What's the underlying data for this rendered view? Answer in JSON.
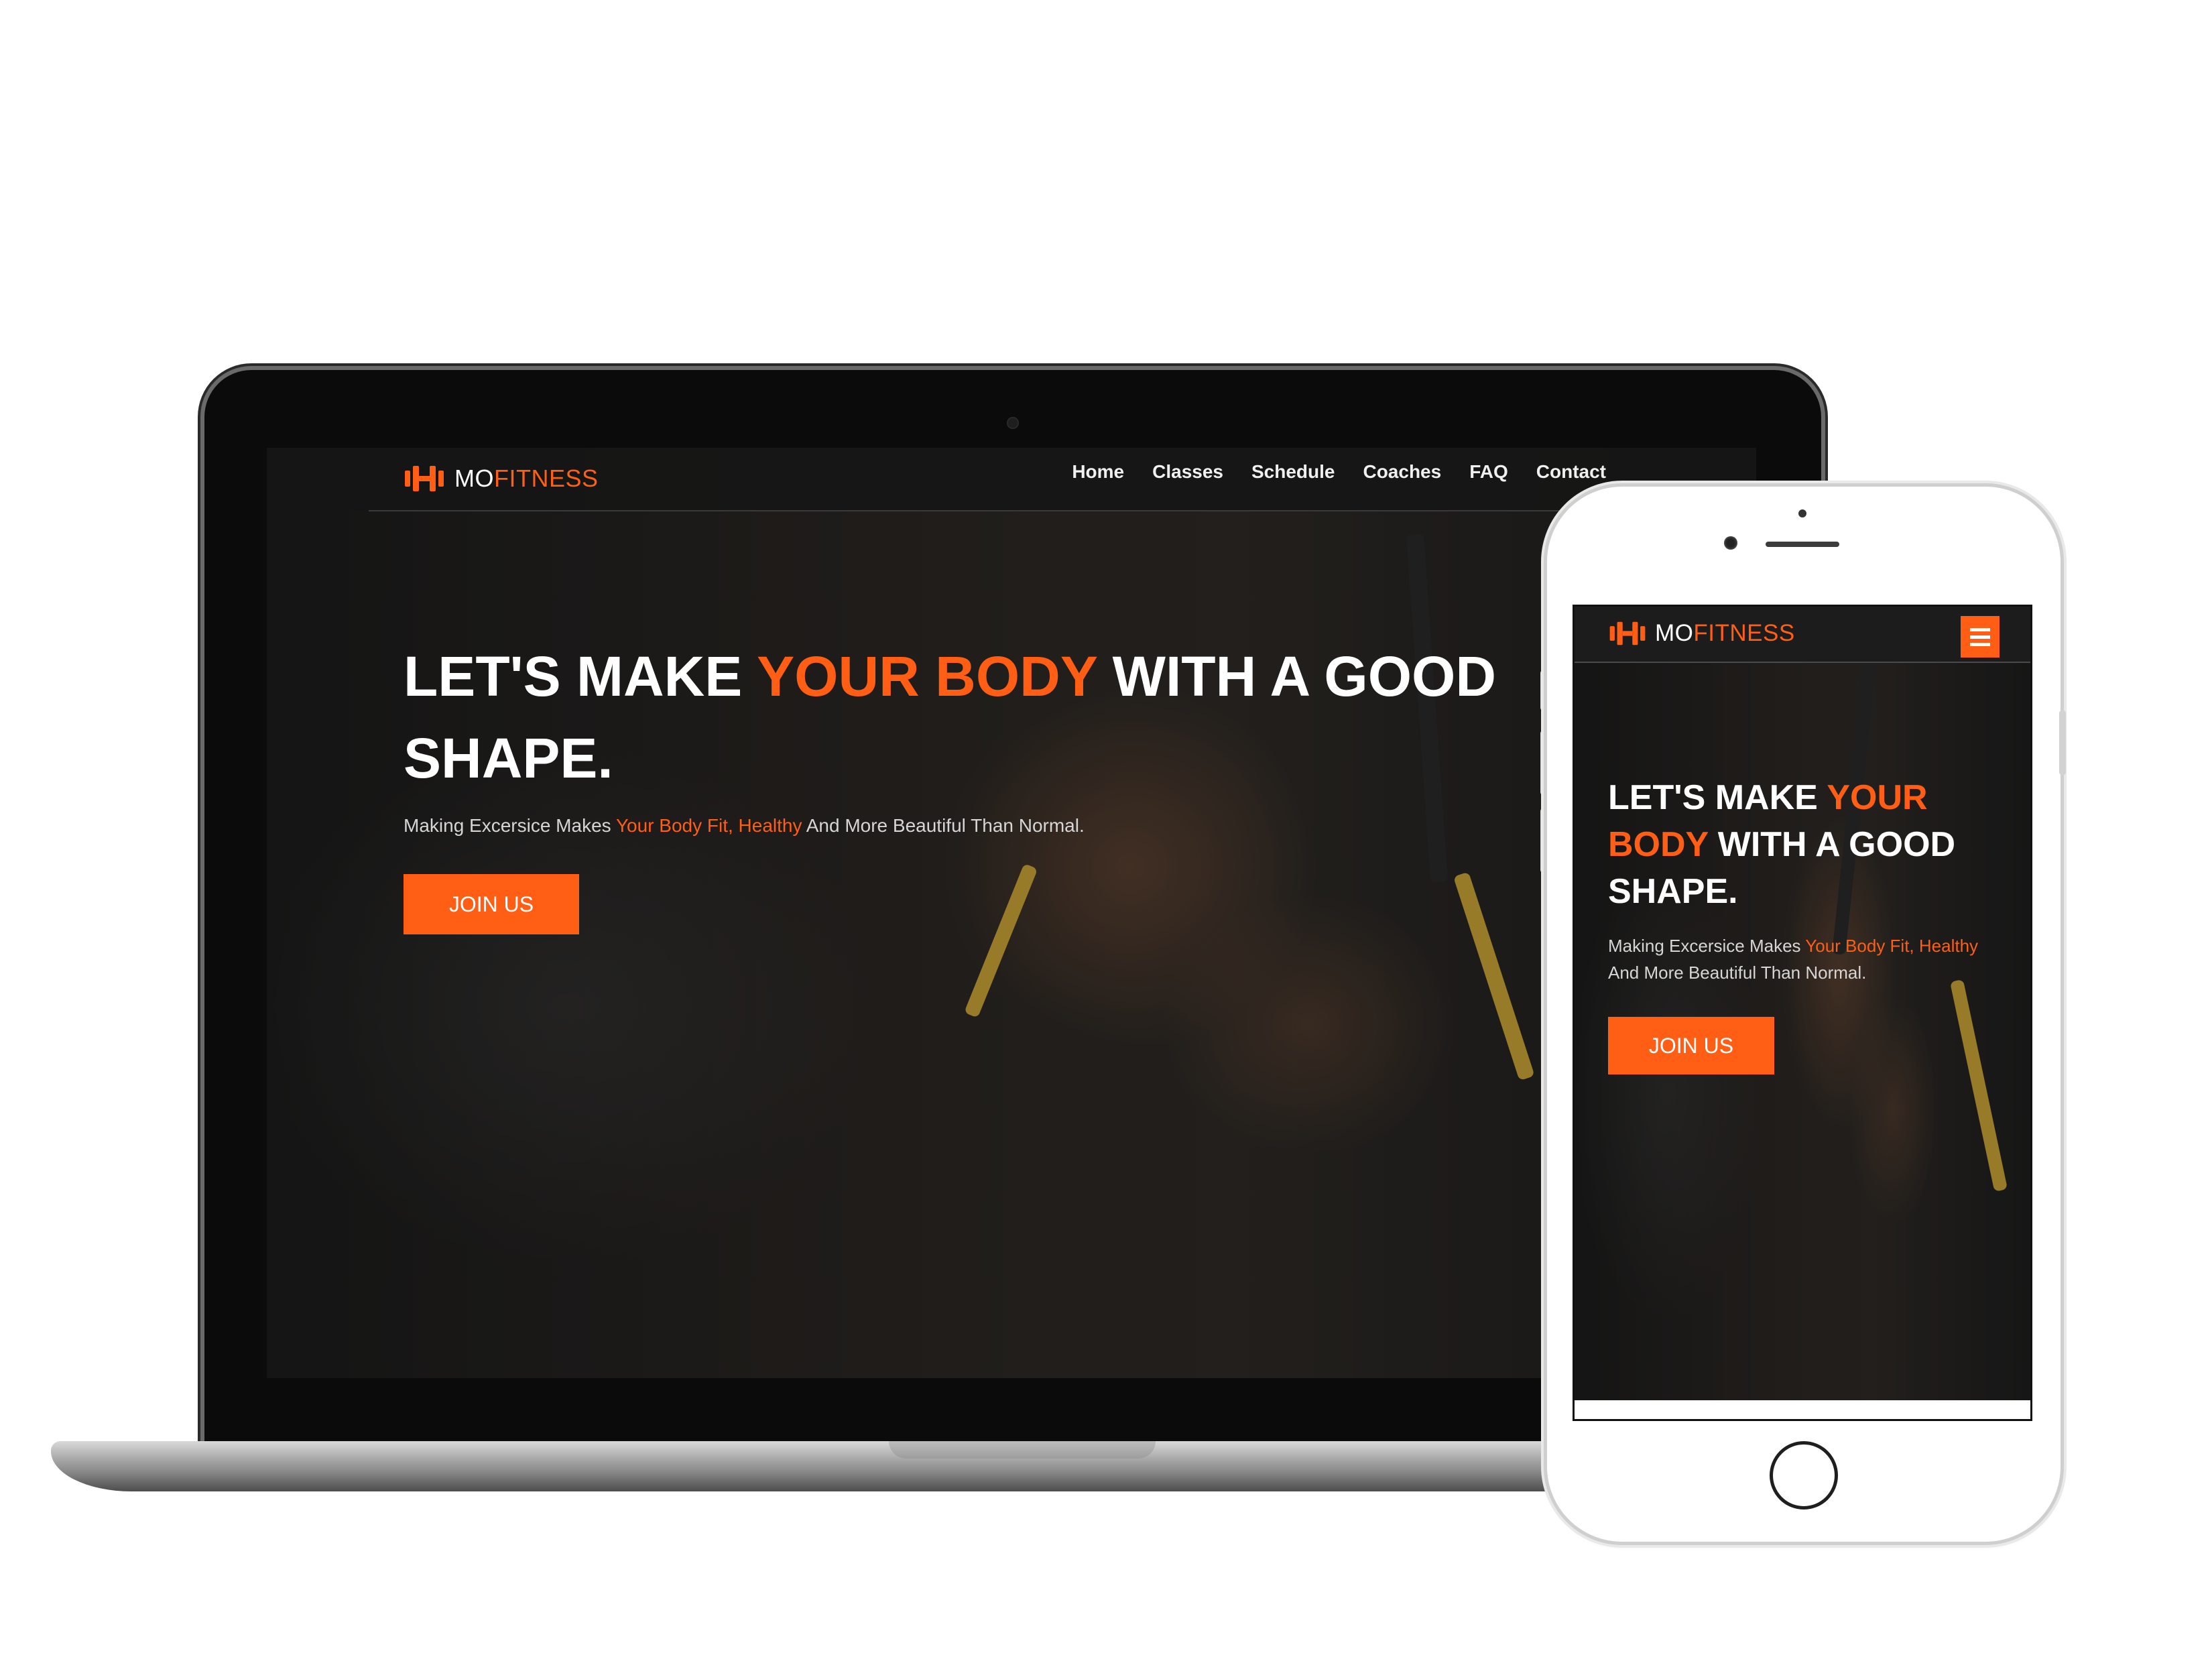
{
  "brand": {
    "prefix": "MO",
    "suffix": "FITNESS",
    "accent_color": "#ff5e14",
    "logo_icon": "dumbbell-icon"
  },
  "nav": {
    "items": [
      "Home",
      "Classes",
      "Schedule",
      "Coaches",
      "FAQ",
      "Contact"
    ]
  },
  "hero": {
    "title_part1": "LET'S MAKE ",
    "title_highlight": "YOUR BODY",
    "title_part2": " WITH A GOOD SHAPE.",
    "subtitle_part1": "Making Excersice Makes ",
    "subtitle_highlight": "Your Body Fit, Healthy",
    "subtitle_part2": " And More Beautiful Than Normal.",
    "cta_label": "JOIN US"
  },
  "mobile": {
    "title_line1_a": "LET'S MAKE ",
    "title_line1_b": "YOUR",
    "title_line2_a": "BODY",
    "title_line2_b": " WITH A GOOD",
    "title_line3": "SHAPE.",
    "menu_icon": "hamburger-menu-icon"
  }
}
